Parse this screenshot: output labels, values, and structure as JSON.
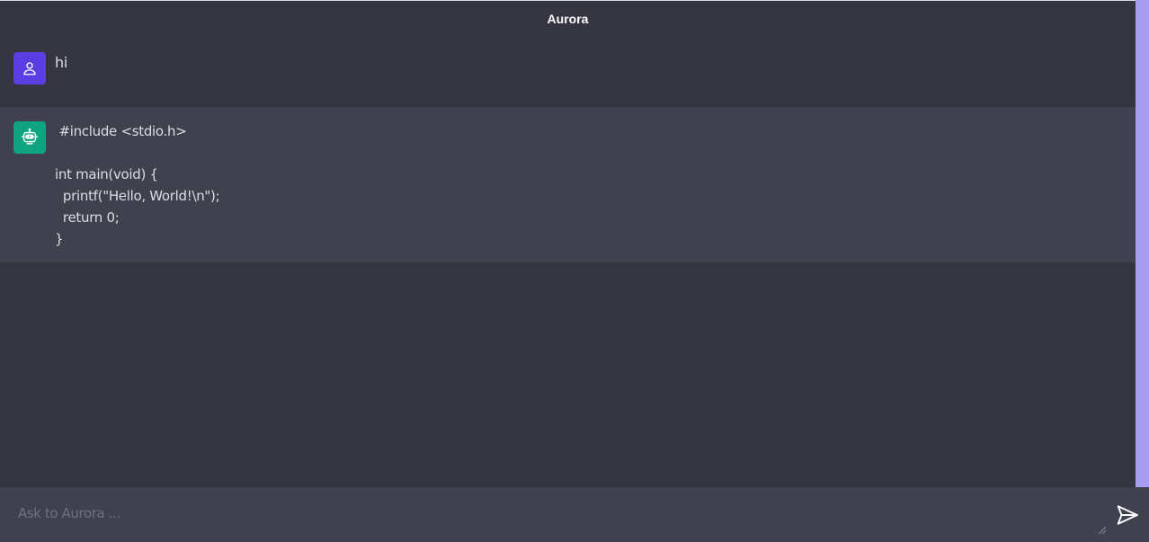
{
  "app": {
    "title": "Aurora",
    "accent_color": "#a99df2",
    "background_color": "#343541"
  },
  "messages": [
    {
      "role": "user",
      "avatar_icon": "user-icon",
      "avatar_color": "#5b3ee3",
      "text": "hi"
    },
    {
      "role": "assistant",
      "avatar_icon": "robot-icon",
      "avatar_color": "#10a37f",
      "text": " #include <stdio.h>\n\nint main(void) {\n  printf(\"Hello, World!\\n\");\n  return 0;\n}"
    }
  ],
  "composer": {
    "placeholder": "Ask to Aurora ...",
    "value": "",
    "send_icon": "send-icon"
  }
}
